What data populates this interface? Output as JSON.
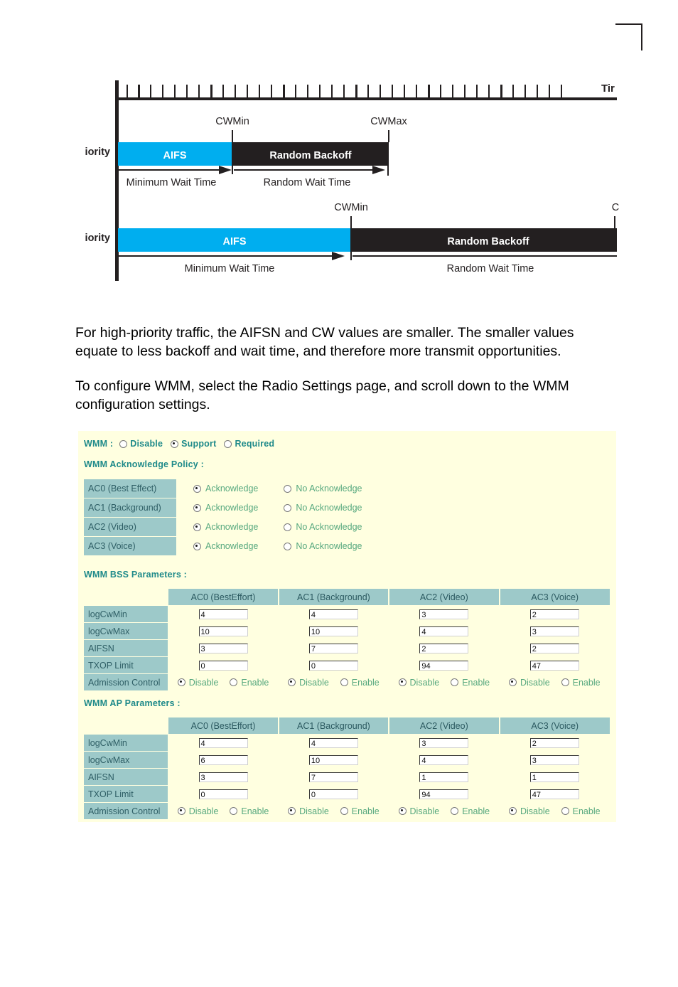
{
  "page": {
    "crop_mark": "corner-crop-mark"
  },
  "diagram": {
    "axis_label": "Tir",
    "row_labels": [
      "iority",
      "iority"
    ],
    "high_priority": {
      "aifs_label": "AIFS",
      "backoff_label": "Random Backoff",
      "cwmin_label": "CWMin",
      "cwmax_label": "CWMax",
      "min_wait_label": "Minimum Wait Time",
      "random_wait_label": "Random Wait Time"
    },
    "low_priority": {
      "aifs_label": "AIFS",
      "backoff_label": "Random Backoff",
      "cwmin_label": "CWMin",
      "cwmax_label": "C",
      "min_wait_label": "Minimum Wait Time",
      "random_wait_label": "Random Wait Time"
    },
    "colors": {
      "aifs": "#00AEEF",
      "backoff": "#231F20",
      "axis": "#231F20"
    }
  },
  "body": {
    "paragraph_1": "For high-priority traffic, the AIFSN and CW values are smaller. The smaller values equate to less backoff and wait time, and therefore more transmit opportunities.",
    "paragraph_2": "To configure WMM, select the Radio Settings page, and scroll down to the WMM configuration settings."
  },
  "wmm": {
    "colors": {
      "panel_bg": "#FFFFE0",
      "header_teal": "#9DC9C9",
      "label_teal": "#1F8A8A",
      "option_green": "#56A87E"
    },
    "mode_row": {
      "label": "WMM :",
      "options": [
        "Disable",
        "Support",
        "Required"
      ],
      "selected": "Support"
    },
    "ack_policy": {
      "title": "WMM Acknowledge Policy :",
      "option_ack": "Acknowledge",
      "option_noack": "No Acknowledge",
      "rows": [
        {
          "ac": "AC0 (Best Effect)",
          "selected": "Acknowledge"
        },
        {
          "ac": "AC1 (Background)",
          "selected": "Acknowledge"
        },
        {
          "ac": "AC2 (Video)",
          "selected": "Acknowledge"
        },
        {
          "ac": "AC3 (Voice)",
          "selected": "Acknowledge"
        }
      ]
    },
    "bss": {
      "title": "WMM BSS Parameters :",
      "columns": [
        "",
        "AC0 (BestEffort)",
        "AC1 (Background)",
        "AC2 (Video)",
        "AC3 (Voice)"
      ],
      "rows": [
        {
          "label": "logCwMin",
          "values": [
            "4",
            "4",
            "3",
            "2"
          ]
        },
        {
          "label": "logCwMax",
          "values": [
            "10",
            "10",
            "4",
            "3"
          ]
        },
        {
          "label": "AIFSN",
          "values": [
            "3",
            "7",
            "2",
            "2"
          ]
        },
        {
          "label": "TXOP Limit",
          "values": [
            "0",
            "0",
            "94",
            "47"
          ]
        }
      ],
      "admission": {
        "label": "Admission Control",
        "option_disable": "Disable",
        "option_enable": "Enable",
        "selected": [
          "Disable",
          "Disable",
          "Disable",
          "Disable"
        ]
      }
    },
    "ap": {
      "title": "WMM AP Parameters :",
      "columns": [
        "",
        "AC0 (BestEffort)",
        "AC1 (Background)",
        "AC2 (Video)",
        "AC3 (Voice)"
      ],
      "rows": [
        {
          "label": "logCwMin",
          "values": [
            "4",
            "4",
            "3",
            "2"
          ]
        },
        {
          "label": "logCwMax",
          "values": [
            "6",
            "10",
            "4",
            "3"
          ]
        },
        {
          "label": "AIFSN",
          "values": [
            "3",
            "7",
            "1",
            "1"
          ]
        },
        {
          "label": "TXOP Limit",
          "values": [
            "0",
            "0",
            "94",
            "47"
          ]
        }
      ],
      "admission": {
        "label": "Admission Control",
        "option_disable": "Disable",
        "option_enable": "Enable",
        "selected": [
          "Disable",
          "Disable",
          "Disable",
          "Disable"
        ]
      }
    }
  }
}
